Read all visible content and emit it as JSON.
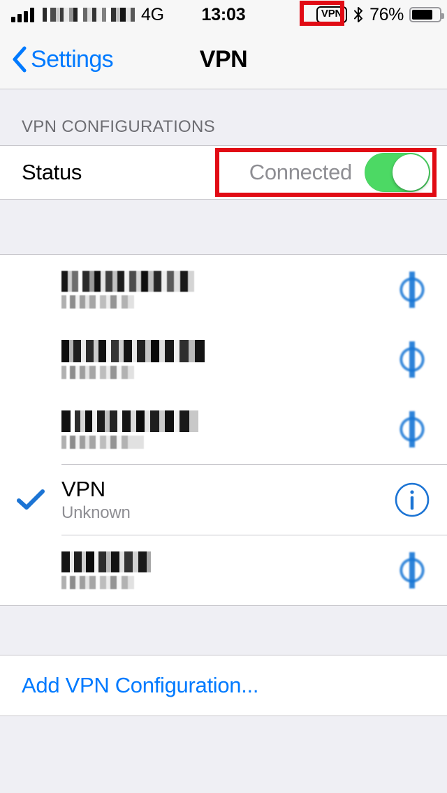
{
  "status_bar": {
    "carrier": "",
    "network": "4G",
    "time": "13:03",
    "vpn_badge": "VPN",
    "bluetooth_icon": "bluetooth-icon",
    "battery_percent": "76%",
    "battery_level": 76
  },
  "nav": {
    "back_label": "Settings",
    "back_icon": "chevron-left-icon",
    "title": "VPN"
  },
  "sections": {
    "configurations_header": "VPN CONFIGURATIONS"
  },
  "status_row": {
    "label": "Status",
    "value": "Connected",
    "toggle_on": true,
    "toggle_color": "#4CD964"
  },
  "vpn_list": [
    {
      "name": "",
      "subtitle": "",
      "redacted": true,
      "selected": false,
      "info_icon": "info-circle-icon"
    },
    {
      "name": "",
      "subtitle": "",
      "redacted": true,
      "selected": false,
      "info_icon": "info-circle-icon"
    },
    {
      "name": "",
      "subtitle": "",
      "redacted": true,
      "selected": false,
      "info_icon": "info-circle-icon"
    },
    {
      "name": "VPN",
      "subtitle": "Unknown",
      "redacted": false,
      "selected": true,
      "info_icon": "info-circle-icon"
    },
    {
      "name": "",
      "subtitle": "",
      "redacted": true,
      "selected": false,
      "info_icon": "info-circle-icon"
    }
  ],
  "add_row": {
    "label": "Add VPN Configuration..."
  },
  "highlights": {
    "color": "#E10B14",
    "regions": [
      "status-bar-vpn-badge",
      "status-row-connected-toggle"
    ]
  },
  "colors": {
    "accent_blue": "#007AFF",
    "toggle_green": "#4CD964",
    "group_bg": "#FFFFFF",
    "page_bg": "#EFEFF4",
    "separator": "#C8C7CC",
    "secondary_text": "#8E8E93",
    "header_text": "#6D6D72"
  }
}
